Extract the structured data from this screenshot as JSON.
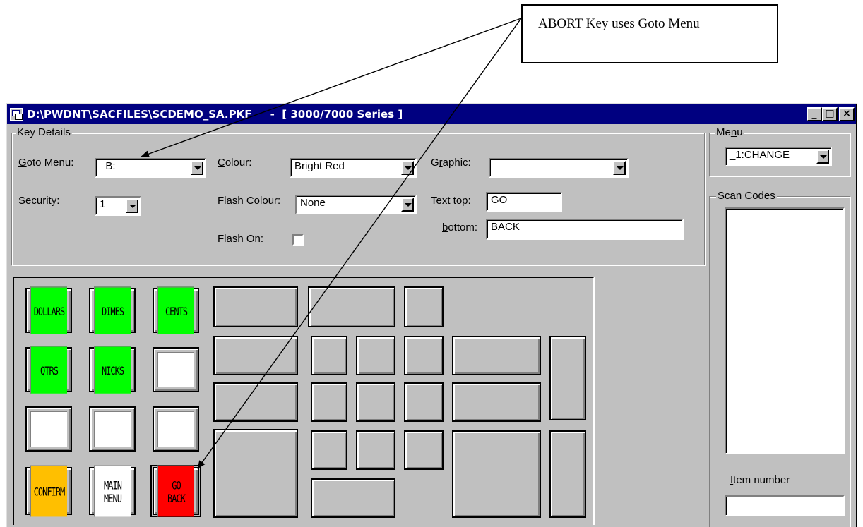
{
  "callout": {
    "text": "ABORT Key uses Goto Menu"
  },
  "window": {
    "title": "D:\\PWDNT\\SACFILES\\SCDEMO_SA.PKF     -  [ 3000/7000 Series ]",
    "buttons": {
      "minimize": "_",
      "maximize": "□",
      "close": "×"
    }
  },
  "key_details": {
    "group_label": "Key Details",
    "goto_menu": {
      "label_pre": "",
      "label_u": "G",
      "label_post": "oto Menu:",
      "value": "_B:"
    },
    "security": {
      "label_u": "S",
      "label_post": "ecurity:",
      "value": "1"
    },
    "colour": {
      "label_u": "C",
      "label_post": "olour:",
      "value": "Bright Red"
    },
    "flash_colour": {
      "label": "Flash Colour:",
      "value": "None"
    },
    "flash_on": {
      "label_pre": "Fl",
      "label_u": "a",
      "label_post": "sh On:",
      "checked": false
    },
    "graphic": {
      "label_pre": "G",
      "label_u": "r",
      "label_post": "aphic:",
      "value": ""
    },
    "text_top": {
      "label_u": "T",
      "label_post": "ext top:",
      "value": "GO"
    },
    "text_bottom": {
      "label_u": "b",
      "label_post": "ottom:",
      "value": "BACK"
    }
  },
  "menu": {
    "group_label_pre": "Me",
    "group_label_u": "n",
    "group_label_post": "u",
    "value": "_1:CHANGE"
  },
  "scan_codes": {
    "group_label": "Scan Codes"
  },
  "item_number": {
    "label_u": "I",
    "label_post": "tem number",
    "value": ""
  },
  "keys": {
    "dollars": {
      "top": "DOLLARS",
      "bottom": ""
    },
    "dimes": {
      "top": "DIMES",
      "bottom": ""
    },
    "cents": {
      "top": "CENTS",
      "bottom": ""
    },
    "qtrs": {
      "top": "QTRS",
      "bottom": ""
    },
    "nicks": {
      "top": "NICKS",
      "bottom": ""
    },
    "confirm": {
      "top": "CONFIRM",
      "bottom": ""
    },
    "main_menu": {
      "top": "MAIN",
      "bottom": "MENU"
    },
    "go_back": {
      "top": "GO",
      "bottom": "BACK"
    }
  },
  "colors": {
    "green": "#00ff00",
    "orange": "#ffbf00",
    "red": "#ff0000",
    "white": "#ffffff",
    "title_bar": "#000080",
    "face": "#c0c0c0"
  }
}
